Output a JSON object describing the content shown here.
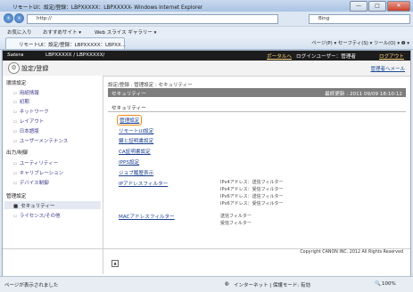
{
  "window": {
    "title": "リモートUI：設定/登録：LBPXXXXX：LBPXXXXX- Windows Internet Explorer",
    "minimize": "—",
    "maximize": "□",
    "close": "✕"
  },
  "browser": {
    "address": "http://",
    "search_placeholder": "Bing",
    "favorites_label": "お気に入り",
    "favorites_items": [
      "おすすめサイト ▾",
      "Web スライス ギャラリー ▾"
    ],
    "tab_title": "リモートUI：設定/登録：LBPXXXXX：LBPXX...",
    "tools_text": "ページ(P) ▾  セーフティ(S) ▾  ツール(O) ▾  ❷ ▾"
  },
  "app": {
    "brand": "Satera",
    "device": "LBPXXXXX / LBPXXXXX/",
    "portal_link": "ポータルへ",
    "login_user": "ログインユーザー：管理者",
    "logout": "ログアウト",
    "page_title": "設定/登録",
    "admin_mail": "管理者へメール"
  },
  "sidebar": {
    "groups": [
      {
        "label": "環境設定",
        "items": [
          "用紙情報",
          "初期",
          "ネットワーク",
          "レイアウト",
          "日本語版",
          "ユーザーメンテナンス"
        ]
      },
      {
        "label": "出力/制御",
        "items": [
          "ユーティリティー",
          "キャリブレーション",
          "デバイス制御"
        ]
      },
      {
        "label": "管理設定",
        "items": [
          "セキュリティー",
          "ライセンス/その他"
        ]
      }
    ],
    "active_item": "セキュリティー"
  },
  "main": {
    "breadcrumb": "設定/登録 : 管理設定 : セキュリティー",
    "section_title": "セキュリティー",
    "last_updated": "最終更新 : 2011 09/09 18:10:12",
    "box_title": "セキュリティー",
    "links": [
      "管理設定",
      "リモートUI設定",
      "鍵と証明書設定",
      "CA証明書設定",
      "IPPS設定",
      "ジョブ履歴表示",
      "IPアドレスフィルター",
      "MACアドレスフィルター"
    ],
    "ip_filter_desc": [
      "IPv4アドレス：送信フィルター",
      "IPv4アドレス：受信フィルター",
      "IPv6アドレス：送信フィルター",
      "IPv6アドレス：受信フィルター"
    ],
    "mac_filter_desc": [
      "送信フィルター",
      "受信フィルター"
    ],
    "top_icon": "▲"
  },
  "footer": {
    "copyright": "Copyright CANON INC. 2012 All Rights Reserved"
  },
  "statusbar": {
    "left": "ページが表示されました",
    "zone": "インターネット | 保護モード: 有効",
    "zoom": "100%"
  }
}
